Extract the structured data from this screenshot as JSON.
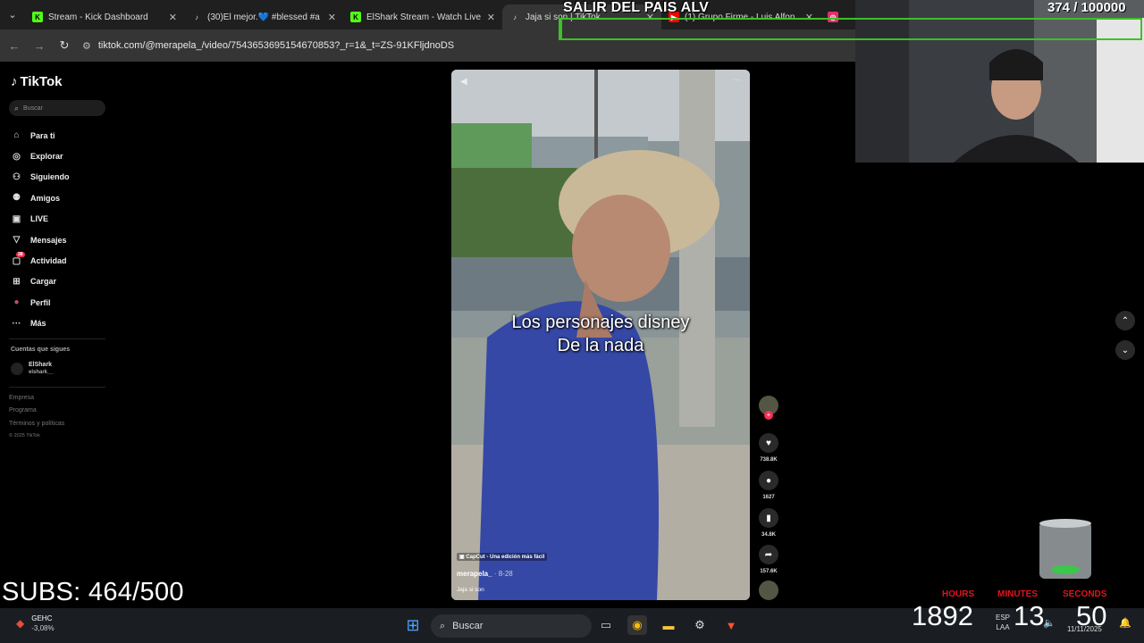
{
  "browser": {
    "tabs": [
      {
        "title": "Stream - Kick Dashboard",
        "icon": "kick-icon",
        "color": "#53fc18",
        "active": false
      },
      {
        "title": "(30)El mejor.💙 #blessed #a",
        "icon": "tiktok-icon",
        "color": "#ffffff",
        "active": false
      },
      {
        "title": "ElShark Stream - Watch Live",
        "icon": "kick-icon",
        "color": "#53fc18",
        "active": false
      },
      {
        "title": "Jaja si son | TikTok",
        "icon": "tiktok-icon",
        "color": "#ffffff",
        "active": true
      },
      {
        "title": "(1) Grupo Firme - Luis Alfon",
        "icon": "youtube-icon",
        "color": "#ff0000",
        "active": false
      },
      {
        "title": "",
        "icon": "instagram-icon",
        "color": "#e1306c",
        "active": false
      }
    ],
    "url": "tiktok.com/@merapela_/video/7543653695154670853?_r=1&_t=ZS-91KFljdnoDS"
  },
  "tiktok": {
    "logo": "TikTok",
    "search_placeholder": "Buscar",
    "menu": [
      {
        "label": "Para ti",
        "icon": "home-icon",
        "glyph": "⌂"
      },
      {
        "label": "Explorar",
        "icon": "compass-icon",
        "glyph": "◎"
      },
      {
        "label": "Siguiendo",
        "icon": "following-icon",
        "glyph": "⚇"
      },
      {
        "label": "Amigos",
        "icon": "friends-icon",
        "glyph": "⚉"
      },
      {
        "label": "LIVE",
        "icon": "live-icon",
        "glyph": "▣"
      },
      {
        "label": "Mensajes",
        "icon": "messages-icon",
        "glyph": "▽"
      },
      {
        "label": "Actividad",
        "icon": "activity-icon",
        "glyph": "▢",
        "badge": "38"
      },
      {
        "label": "Cargar",
        "icon": "upload-icon",
        "glyph": "⊞"
      },
      {
        "label": "Perfil",
        "icon": "profile-icon",
        "glyph": "●"
      },
      {
        "label": "Más",
        "icon": "more-icon",
        "glyph": "···"
      }
    ],
    "following_header": "Cuentas que sigues",
    "following": [
      {
        "name": "ElShark",
        "username": "elshark__"
      }
    ],
    "footer": [
      "Empresa",
      "Programa",
      "Términos y políticas"
    ],
    "copyright": "© 2025 TikTok"
  },
  "video": {
    "caption_line1": "Los personajes disney",
    "caption_line2": "De la nada",
    "capcut": "CapCut - Una edición más fácil",
    "author": "merapela_",
    "date": " · 8-28",
    "description": "Jaja si son",
    "likes": "738.8K",
    "comments": "1627",
    "saves": "34.8K",
    "shares": "157.6K"
  },
  "overlay": {
    "goal_title": "SALIR DEL PAIS ALV",
    "goal_current": "374",
    "goal_separator": "/",
    "goal_target": "100000",
    "goal_progress": 0.00374,
    "subs": "SUBS: 464/500",
    "timer": {
      "hours_label": "HOURS",
      "hours": "1892",
      "minutes_label": "MINUTES",
      "minutes": "13",
      "seconds_label": "SECONDS",
      "seconds": "50"
    }
  },
  "taskbar": {
    "ticker_name": "GEHC",
    "ticker_change": "-3,08%",
    "search_label": "Buscar",
    "lang_top": "ESP",
    "lang_bottom": "LAA",
    "date": "11/11/2025"
  }
}
